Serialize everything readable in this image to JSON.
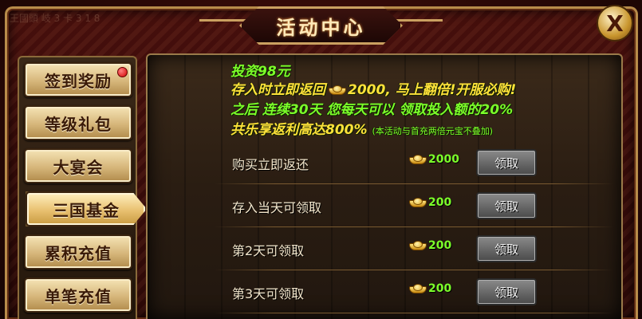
{
  "header": {
    "watermark": "王國頭 岐 3 卡 3 1 8",
    "title": "活动中心"
  },
  "close_label": "X",
  "sidebar": {
    "items": [
      {
        "label": "签到奖励",
        "has_badge": true
      },
      {
        "label": "等级礼包"
      },
      {
        "label": "大宴会"
      },
      {
        "label": "三国基金",
        "active": true
      },
      {
        "label": "累积充值"
      },
      {
        "label": "单笔充值"
      }
    ]
  },
  "promo": {
    "line1": "投资98元",
    "line2_a": "存入时立即返回",
    "line2_b": "2000, 马上翻倍!开服必购!",
    "line3": "之后 连续30天 您每天可以 领取投入额的20%",
    "line4": "共乐享返利高达800%",
    "note": "(本活动与首充两倍元宝不叠加)"
  },
  "rewards": [
    {
      "label": "购买立即返还",
      "amount": "2000",
      "button": "领取"
    },
    {
      "label": "存入当天可领取",
      "amount": "200",
      "button": "领取"
    },
    {
      "label": "第2天可领取",
      "amount": "200",
      "button": "领取"
    },
    {
      "label": "第3天可领取",
      "amount": "200",
      "button": "领取"
    }
  ],
  "colors": {
    "promo_yellow": "#ffe23a",
    "promo_green": "#7cff2a",
    "amount_green": "#7cff2a",
    "badge_red": "#d00000"
  }
}
